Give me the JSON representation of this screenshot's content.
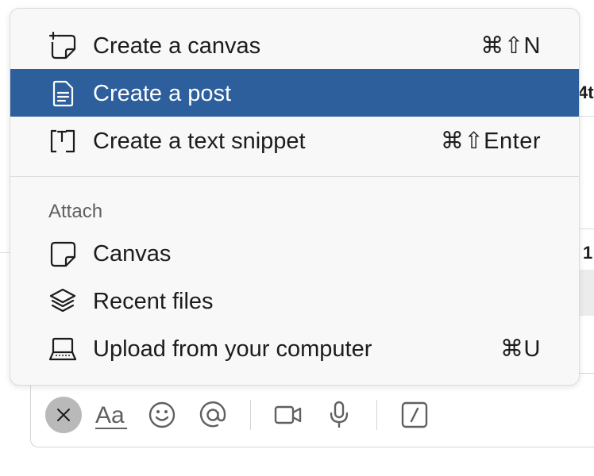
{
  "menu": {
    "items": [
      {
        "label": "Create a canvas",
        "shortcut": "⌘⇧N",
        "icon": "canvas-plus-icon"
      },
      {
        "label": "Create a post",
        "shortcut": "",
        "icon": "post-icon",
        "selected": true
      },
      {
        "label": "Create a text snippet",
        "shortcut": "⌘⇧Enter",
        "icon": "snippet-icon"
      }
    ],
    "attach_section": {
      "title": "Attach",
      "items": [
        {
          "label": "Canvas",
          "shortcut": "",
          "icon": "canvas-icon"
        },
        {
          "label": "Recent files",
          "shortcut": "",
          "icon": "layers-icon"
        },
        {
          "label": "Upload from your computer",
          "shortcut": "⌘U",
          "icon": "laptop-icon"
        }
      ]
    }
  },
  "background": {
    "peek_text_1": "4t",
    "peek_text_2": "1"
  },
  "composer": {
    "tools": [
      "close-icon",
      "text-format-icon",
      "emoji-icon",
      "mention-icon",
      "video-icon",
      "microphone-icon",
      "slash-command-icon"
    ],
    "format_label": "Aa"
  },
  "colors": {
    "selected_bg": "#2c5f9c",
    "menu_bg": "#f8f8f8",
    "text": "#1d1c1d"
  }
}
